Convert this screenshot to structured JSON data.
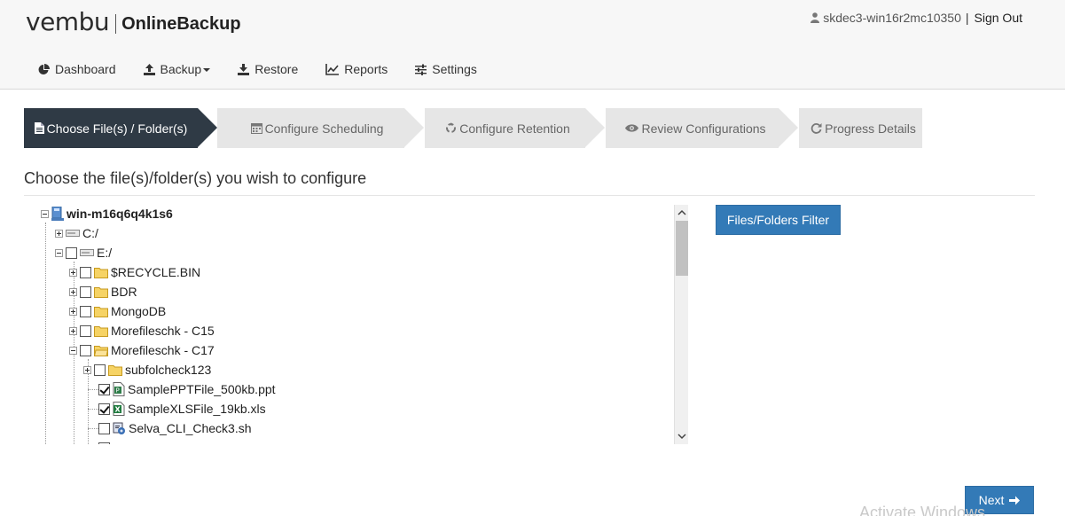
{
  "brand": {
    "logo_word": "vembu",
    "product": "OnlineBackup"
  },
  "user": {
    "name": "skdec3-win16r2mc10350",
    "separator": "|",
    "signout": "Sign Out"
  },
  "nav": [
    {
      "label": "Dashboard",
      "icon": "pie-chart-icon"
    },
    {
      "label": "Backup",
      "icon": "upload-icon",
      "has_dropdown": true
    },
    {
      "label": "Restore",
      "icon": "download-icon"
    },
    {
      "label": "Reports",
      "icon": "line-chart-icon"
    },
    {
      "label": "Settings",
      "icon": "sliders-icon"
    }
  ],
  "wizard": [
    {
      "label": "Choose File(s) / Folder(s)",
      "icon": "file-icon",
      "active": true
    },
    {
      "label": "Configure Scheduling",
      "icon": "calendar-icon",
      "active": false
    },
    {
      "label": "Configure Retention",
      "icon": "recycle-icon",
      "active": false
    },
    {
      "label": "Review Configurations",
      "icon": "eye-icon",
      "active": false
    },
    {
      "label": "Progress Details",
      "icon": "refresh-icon",
      "active": false
    }
  ],
  "heading": "Choose the file(s)/folder(s) you wish to configure",
  "tree": {
    "root": "win-m16q6q4k1s6",
    "drive_c": "C:/",
    "drive_e": "E:/",
    "items": [
      {
        "label": "$RECYCLE.BIN",
        "type": "folder",
        "checked": false
      },
      {
        "label": "BDR",
        "type": "folder",
        "checked": false
      },
      {
        "label": "MongoDB",
        "type": "folder",
        "checked": false
      },
      {
        "label": "Morefileschk - C15",
        "type": "folder",
        "checked": false
      },
      {
        "label": "Morefileschk - C17",
        "type": "folder",
        "checked": false,
        "expanded": true
      },
      {
        "label": "subfolcheck123",
        "type": "folder",
        "checked": false
      },
      {
        "label": "SamplePPTFile_500kb.ppt",
        "type": "ppt",
        "checked": true
      },
      {
        "label": "SampleXLSFile_19kb.xls",
        "type": "xls",
        "checked": true
      },
      {
        "label": "Selva_CLI_Check3.sh",
        "type": "script",
        "checked": false
      }
    ]
  },
  "buttons": {
    "filter": "Files/Folders Filter",
    "next": "Next"
  },
  "watermark": "Activate Windows",
  "colors": {
    "primary": "#337ab7",
    "active_step": "#2f3a45",
    "step_bg": "#e6e6e6"
  }
}
